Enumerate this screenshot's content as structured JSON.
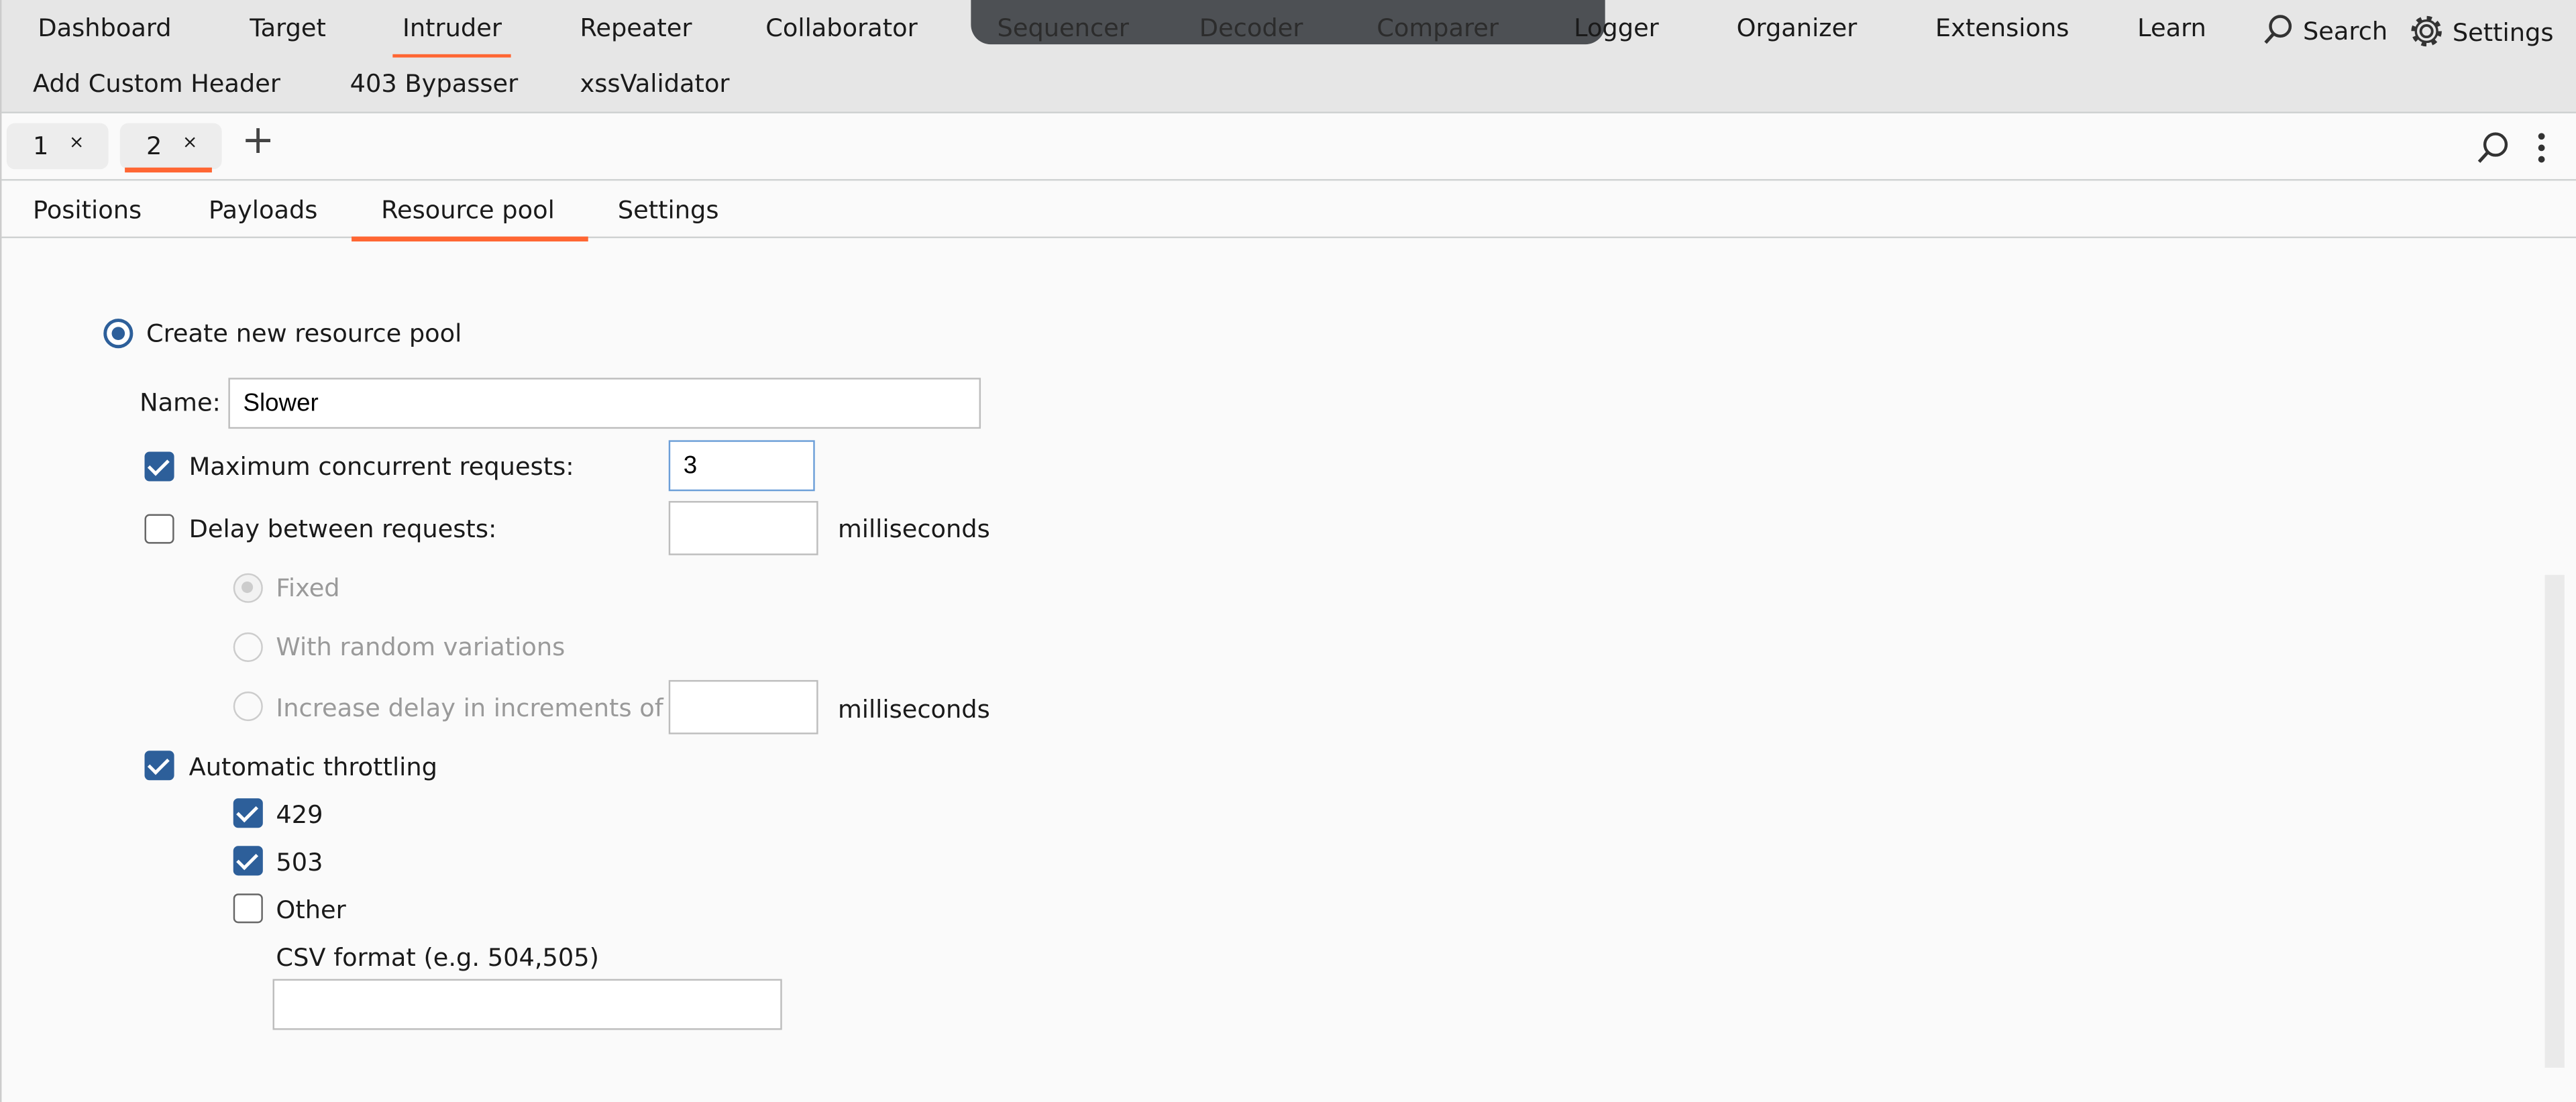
{
  "nav": {
    "items": [
      "Dashboard",
      "Target",
      "Intruder",
      "Repeater",
      "Collaborator",
      "Sequencer",
      "Decoder",
      "Comparer",
      "Logger",
      "Organizer",
      "Extensions",
      "Learn"
    ],
    "search_label": "Search",
    "settings_label": "Settings",
    "extensions": [
      "Add Custom Header",
      "403 Bypasser",
      "xssValidator"
    ],
    "active": "Intruder"
  },
  "request_tabs": [
    {
      "label": "1",
      "close": "×"
    },
    {
      "label": "2",
      "close": "×"
    }
  ],
  "add_tab": "+",
  "subtabs": [
    "Positions",
    "Payloads",
    "Resource pool",
    "Settings"
  ],
  "form": {
    "create_new": "Create new resource pool",
    "name_label": "Name:",
    "name_value": "Slower",
    "max_concurrent_label": "Maximum concurrent requests:",
    "max_concurrent_value": "3",
    "max_concurrent_checked": true,
    "delay_label": "Delay between requests:",
    "delay_value": "",
    "delay_checked": false,
    "milliseconds": "milliseconds",
    "fixed": "Fixed",
    "random": "With random variations",
    "increase": "Increase delay in increments of",
    "increase_value": "",
    "throttling_label": "Automatic throttling",
    "throttling_checked": true,
    "code_429": "429",
    "code_503": "503",
    "other": "Other",
    "csv_label": "CSV format (e.g. 504,505)",
    "csv_value": ""
  },
  "colors": {
    "accent": "#ff6633",
    "checkbox": "#2d5f9a"
  }
}
